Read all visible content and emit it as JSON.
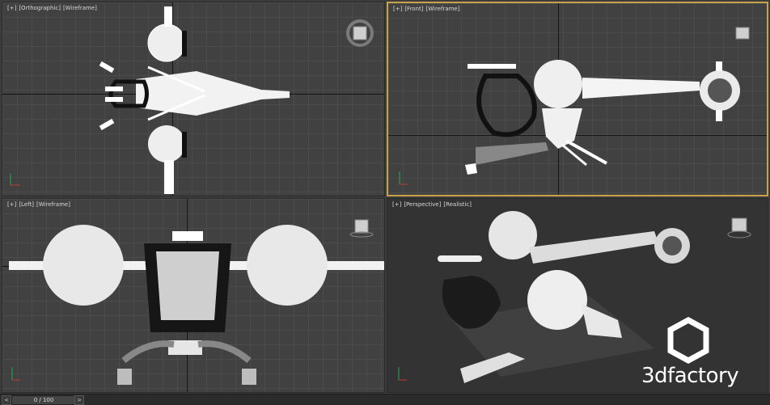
{
  "viewports": [
    {
      "id": "top",
      "labels": [
        "[+]",
        "[Orthographic]",
        "[Wireframe]"
      ]
    },
    {
      "id": "front",
      "labels": [
        "[+]",
        "[Front]",
        "[Wireframe]"
      ]
    },
    {
      "id": "left",
      "labels": [
        "[+]",
        "[Left]",
        "[Wireframe]"
      ]
    },
    {
      "id": "perspective",
      "labels": [
        "[+]",
        "[Perspective]",
        "[Realistic]"
      ]
    }
  ],
  "timeline": {
    "slider_label": "0 / 100",
    "prev": "<",
    "next": ">"
  },
  "brand": {
    "text": "3dfactory"
  },
  "colors": {
    "active_border": "#c8a24a",
    "viewport_bg": "#414141",
    "grid": "#4b4b4b"
  }
}
